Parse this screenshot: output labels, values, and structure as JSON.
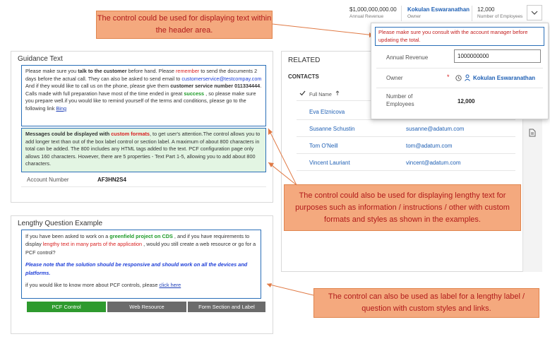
{
  "header": {
    "annual_revenue_value": "$1,000,000,000.00",
    "annual_revenue_label": "Annual Revenue",
    "owner_value": "Kokulan Eswaranathan",
    "owner_label": "Owner",
    "employees_value": "12,000",
    "employees_label": "Number of Employees",
    "chevron_icon": "chevron-down-icon"
  },
  "callouts": {
    "header_text": "The control could be used for displaying text within the header area.",
    "lengthy_text": "The control could also be used for displaying lengthy text for purposes such as information / instructions / other with custom formats and styles as shown in the examples.",
    "label_text": "The control can also be used as label for a lengthy label / question with custom styles and links."
  },
  "guidance": {
    "title": "Guidance Text",
    "p1_a": "Please make sure you ",
    "p1_b": "talk to the customer",
    "p1_c": " before hand. Please ",
    "p1_d": "remember",
    "p1_e": " to send the documents 2 days before the actual call. They can also be asked to send email to ",
    "p1_f": "customerservice@testcompay.com",
    "p1_g": " And if they would like to call us on the phone, please give them ",
    "p1_h": "customer service number 011334444",
    "p1_i": ". Calls made with full preparation have most of the time ended in great ",
    "p1_j": "success",
    "p1_k": " , so please make sure you prepare well.if you would like to remind yourself of the terms and conditions, please go to the following link ",
    "p1_l": "Bing",
    "p2_a": "Messages could be displayed with ",
    "p2_b": "custom formats",
    "p2_c": ", to get user's attention.",
    "p2_d": "The control allows you to add longer text than out of the box label control or section label. A maximum of about 800 characters in total can be added. The 800 includes any HTML tags added to the text. PCF configuration page only allows 160 characters. However, there are 5 properties - Text Part 1-5, allowing you to add about 800 characters.",
    "account_number_label": "Account Number",
    "account_number_value": "AF3HN2S4"
  },
  "lengthy": {
    "title": "Lengthy Question Example",
    "q_a": "If you have been asked to work on a ",
    "q_b": "greenfield project on CDS",
    "q_c": " , and if you have requirements to display ",
    "q_d": "lengthy text in many parts of the application",
    "q_e": " , would you still create a web resource or go for a PCF control?",
    "note": "Please note that the solution should be responsive and should work on all the devices and platforms.",
    "more_a": "if you would like to know more about PCF controls, please ",
    "more_b": "click here",
    "buttons": [
      "PCF Control",
      "Web Resource",
      "Form Section and Label"
    ]
  },
  "related": {
    "title": "RELATED",
    "contacts_label": "CONTACTS",
    "col_full_name": "Full Name",
    "sort_icon": "sort-up-icon",
    "check_icon": "check-icon",
    "document_icon": "document-icon",
    "contacts": [
      {
        "name": "Eva Elznicova",
        "email": ""
      },
      {
        "name": "Susanne Schustin",
        "email": "susanne@adatum.com"
      },
      {
        "name": "Tom O'Neill",
        "email": "tom@adatum.com"
      },
      {
        "name": "Vincent Lauriant",
        "email": "vincent@adatum.com"
      }
    ]
  },
  "popup": {
    "message": "Please make sure you consult with the account manager before updating the total.",
    "annual_revenue_label": "Annual Revenue",
    "annual_revenue_value": "1000000000",
    "owner_label": "Owner",
    "owner_required": "*",
    "owner_value": "Kokulan Eswaranathan",
    "employees_label": "Number of Employees",
    "employees_value": "12,000"
  },
  "colors": {
    "callout_fill": "#f4a97e",
    "callout_text": "#b11b1b",
    "box_border": "#2a6fb8",
    "messages_bg": "#e3f5e3",
    "pcf_button": "#2e9a2e",
    "gray_button": "#6b6b6b"
  }
}
